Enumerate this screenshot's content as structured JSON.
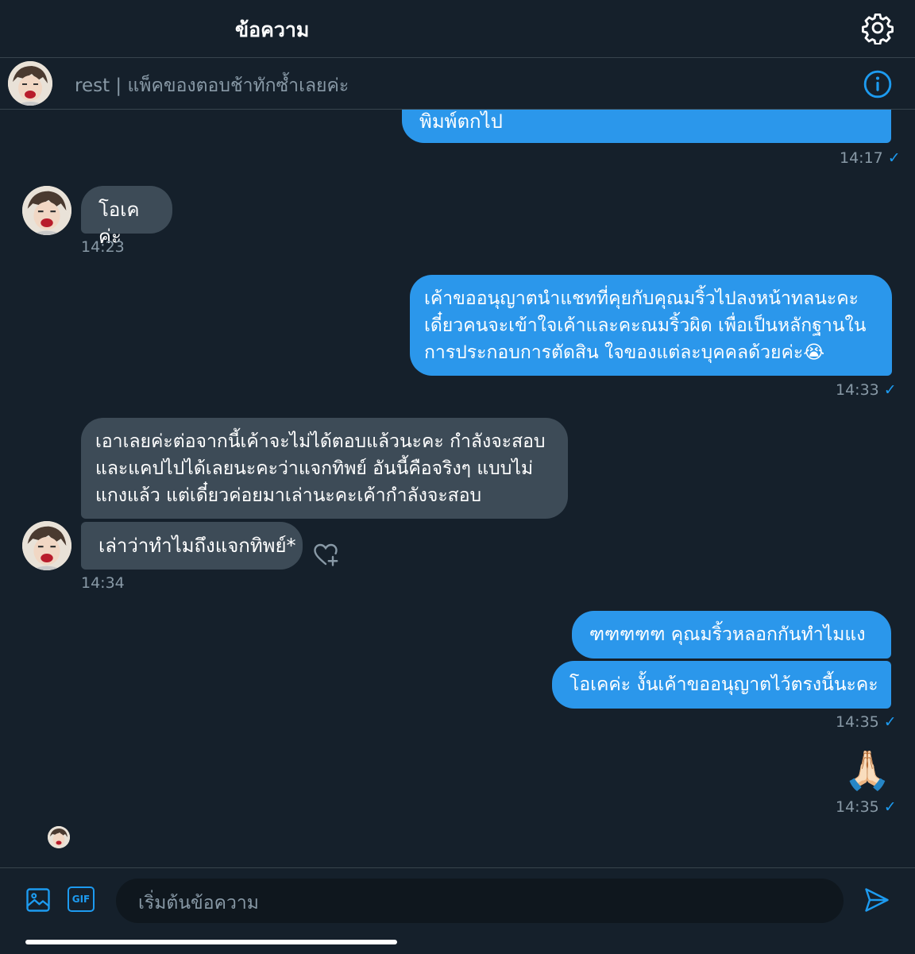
{
  "header": {
    "title": "ข้อความ",
    "settings_icon": "gear-icon"
  },
  "conversation": {
    "name": "rest | แพ็คของตอบช้าทักซ้ำเลยค่ะ",
    "info_icon": "info-icon"
  },
  "messages": [
    {
      "from": "me",
      "text": "พิมพ์ตกไป",
      "time": "14:17"
    },
    {
      "from": "them",
      "text": "โอเคค่ะ",
      "time": "14:23"
    },
    {
      "from": "me",
      "lines": [
        "เค้าขออนุญาตนำแชทที่คุยกับคุณมริ้วไปลงหน้าทลนะคะ",
        "เดี๋ยวคนจะเข้าใจเค้าและคะณมริ้วผิด เพื่อเป็นหลักฐานใน",
        "การประกอบการตัดสิน ใจของแต่ละบุคคลด้วยค่ะ😭"
      ],
      "time": "14:33"
    },
    {
      "from": "them",
      "lines": [
        "เอาเลยค่ะต่อจากนี้เค้าจะไม่ได้ตอบแล้วนะคะ กำลังจะสอบ",
        "และแคปไปได้เลยนะคะว่าแจกทิพย์ อันนี้คือจริงๆ แบบไม่",
        "แกงแล้ว แต่เดี๋ยวค่อยมาเล่านะคะเค้ากำลังจะสอบ"
      ]
    },
    {
      "from": "them",
      "text": "เล่าว่าทำไมถึงแจกทิพย์*",
      "time": "14:34"
    },
    {
      "from": "me",
      "text": "ฑฑฑฑฑ คุณมริ้วหลอกกันทำไมแง"
    },
    {
      "from": "me",
      "text": "โอเคค่ะ งั้นเค้าขออนุญาตไว้ตรงนี้นะคะ",
      "time": "14:35"
    },
    {
      "from": "me",
      "text": "🙏🏻",
      "time": "14:35"
    }
  ],
  "read_check": "✓",
  "react_icon": "heart-plus-icon",
  "composer": {
    "placeholder": "เริ่มต้นข้อความ",
    "image_icon": "image-icon",
    "gif_label": "GIF",
    "send_icon": "send-icon"
  }
}
